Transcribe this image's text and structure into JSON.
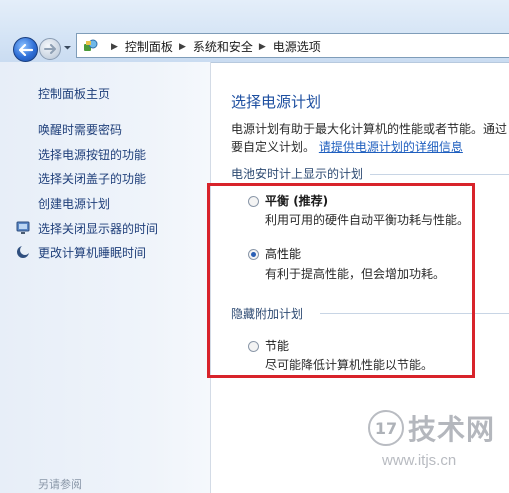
{
  "address_bar": {
    "breadcrumbs": [
      "控制面板",
      "系统和安全",
      "电源选项"
    ]
  },
  "sidebar": {
    "home": "控制面板主页",
    "links": [
      {
        "label": "唤醒时需要密码",
        "icon": null
      },
      {
        "label": "选择电源按钮的功能",
        "icon": null
      },
      {
        "label": "选择关闭盖子的功能",
        "icon": null
      },
      {
        "label": "创建电源计划",
        "icon": null
      },
      {
        "label": "选择关闭显示器的时间",
        "icon": "display-icon"
      },
      {
        "label": "更改计算机睡眠时间",
        "icon": "moon-icon"
      }
    ],
    "footer": "另请参阅"
  },
  "main": {
    "title": "选择电源计划",
    "description_line1": "电源计划有助于最大化计算机的性能或者节能。通过",
    "description_line2": "要自定义计划。",
    "description_link": "请提供电源计划的详细信息",
    "groups": [
      {
        "header": "电池安时计上显示的计划",
        "plans": [
          {
            "name": "平衡",
            "suffix": " (推荐)",
            "desc": "利用可用的硬件自动平衡功耗与性能。",
            "selected": false
          },
          {
            "name": "高性能",
            "suffix": "",
            "desc": "有利于提高性能，但会增加功耗。",
            "selected": true
          }
        ]
      },
      {
        "header": "隐藏附加计划",
        "plans": [
          {
            "name": "节能",
            "suffix": "",
            "desc": "尽可能降低计算机性能以节能。",
            "selected": false
          }
        ]
      }
    ]
  },
  "watermark": {
    "logo": "17",
    "title": "技术网",
    "url": "www.itjs.cn"
  },
  "colors": {
    "link": "#1f3f7a",
    "title": "#1e4fa0",
    "highlight_box": "#d8232a"
  }
}
